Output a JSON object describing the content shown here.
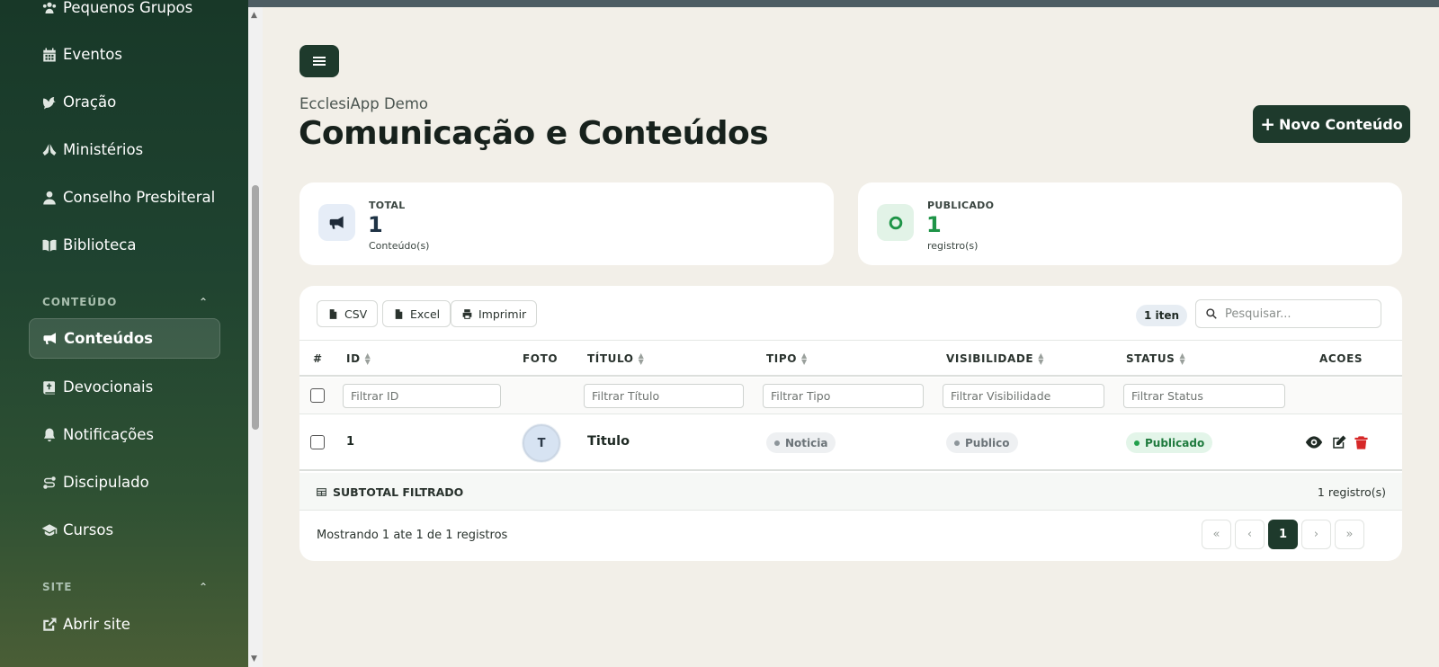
{
  "sidebar": {
    "items": [
      {
        "label": "Pequenos Grupos",
        "icon": "people-group-icon"
      },
      {
        "label": "Eventos",
        "icon": "calendar-icon"
      },
      {
        "label": "Oração",
        "icon": "dove-icon"
      },
      {
        "label": "Ministérios",
        "icon": "hands-praying-icon"
      },
      {
        "label": "Conselho Presbiteral",
        "icon": "user-tie-icon"
      },
      {
        "label": "Biblioteca",
        "icon": "book-open-icon"
      }
    ],
    "section_conteudo": "CONTEÚDO",
    "content_items": [
      {
        "label": "Conteúdos",
        "icon": "bullhorn-icon",
        "active": true
      },
      {
        "label": "Devocionais",
        "icon": "bible-icon"
      },
      {
        "label": "Notificações",
        "icon": "bell-icon"
      },
      {
        "label": "Discipulado",
        "icon": "route-icon"
      },
      {
        "label": "Cursos",
        "icon": "graduation-cap-icon"
      }
    ],
    "section_site": "SITE",
    "site_items": [
      {
        "label": "Abrir site",
        "icon": "external-link-icon"
      }
    ]
  },
  "header": {
    "org": "EcclesiApp Demo",
    "title": "Comunicação e Conteúdos",
    "new_button": "Novo Conteúdo"
  },
  "stats": {
    "total": {
      "label": "TOTAL",
      "value": "1",
      "sub": "Conteúdo(s)"
    },
    "published": {
      "label": "PUBLICADO",
      "value": "1",
      "sub": "registro(s)"
    }
  },
  "toolbar": {
    "csv": "CSV",
    "excel": "Excel",
    "print": "Imprimir",
    "count": "1 iten",
    "search_placeholder": "Pesquisar..."
  },
  "table": {
    "headers": {
      "hash": "#",
      "id": "ID",
      "foto": "FOTO",
      "titulo": "TÍTULO",
      "tipo": "TIPO",
      "visibilidade": "VISIBILIDADE",
      "status": "STATUS",
      "acoes": "ACOES"
    },
    "filters": {
      "id": "Filtrar ID",
      "titulo": "Filtrar Título",
      "tipo": "Filtrar Tipo",
      "visibilidade": "Filtrar Visibilidade",
      "status": "Filtrar Status"
    },
    "rows": [
      {
        "id": "1",
        "avatar": "T",
        "titulo": "Titulo",
        "tipo": "Noticia",
        "visibilidade": "Publico",
        "status": "Publicado"
      }
    ]
  },
  "subtotal": {
    "label": "SUBTOTAL FILTRADO",
    "value": "1 registro(s)"
  },
  "footer": {
    "showing": "Mostrando 1 ate 1 de 1 registros",
    "pages": {
      "first": "«",
      "prev": "‹",
      "current": "1",
      "next": "›",
      "last": "»"
    }
  },
  "colors": {
    "primary": "#1e3a2c",
    "background": "#f2efe8",
    "published": "#22a04c"
  }
}
